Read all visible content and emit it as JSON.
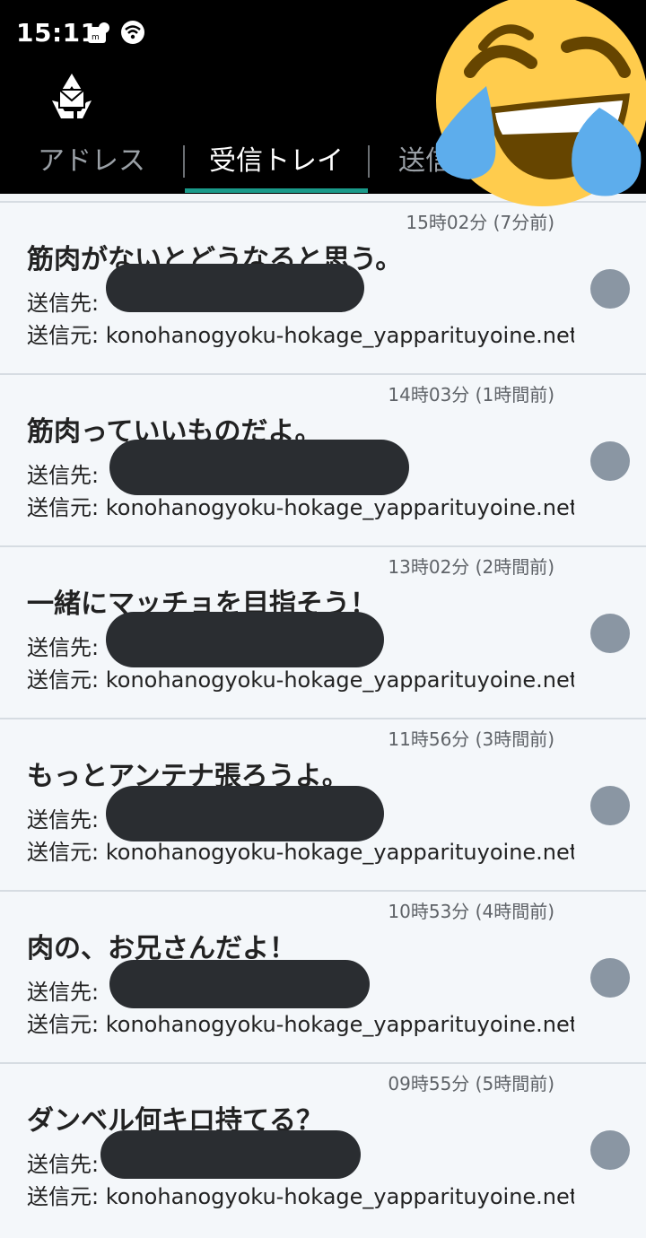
{
  "status_bar": {
    "time": "15:11",
    "icons": [
      "notification-icon",
      "wifi-icon"
    ]
  },
  "app": {
    "logo": "recycle-mail-icon"
  },
  "tabs": [
    {
      "label": "アドレス",
      "active": false
    },
    {
      "label": "受信トレイ",
      "active": true
    },
    {
      "label": "送信トレイ",
      "active": false
    }
  ],
  "overlay": {
    "emoji": "face-with-tears-of-joy"
  },
  "mail_labels": {
    "to": "送信先:",
    "from": "送信元:"
  },
  "messages": [
    {
      "time": "15時02分 (7分前)",
      "subject": "筋肉がないとどうなると思う。",
      "from": "konohanogyoku-hokage_yapparituyoine.net",
      "unread": true
    },
    {
      "time": "14時03分 (1時間前)",
      "subject": "筋肉っていいものだよ。",
      "from": "konohanogyoku-hokage_yapparituyoine.net",
      "unread": true
    },
    {
      "time": "13時02分 (2時間前)",
      "subject": "一緒にマッチョを目指そう！",
      "from": "konohanogyoku-hokage_yapparituyoine.net",
      "unread": true
    },
    {
      "time": "11時56分 (3時間前)",
      "subject": "もっとアンテナ張ろうよ。",
      "from": "konohanogyoku-hokage_yapparituyoine.net",
      "unread": true
    },
    {
      "time": "10時53分 (4時間前)",
      "subject": "肉の、お兄さんだよ！",
      "from": "konohanogyoku-hokage_yapparituyoine.net",
      "unread": true
    },
    {
      "time": "09時55分 (5時間前)",
      "subject": "ダンベル何キロ持てる？",
      "from": "konohanogyoku-hokage_yapparituyoine.net",
      "unread": true
    }
  ],
  "colors": {
    "header_bg": "#000000",
    "tab_indicator": "#1a9a8a",
    "list_bg": "#f4f7fa",
    "unread_dot": "#8a96a3",
    "redaction": "#2a2d31"
  }
}
